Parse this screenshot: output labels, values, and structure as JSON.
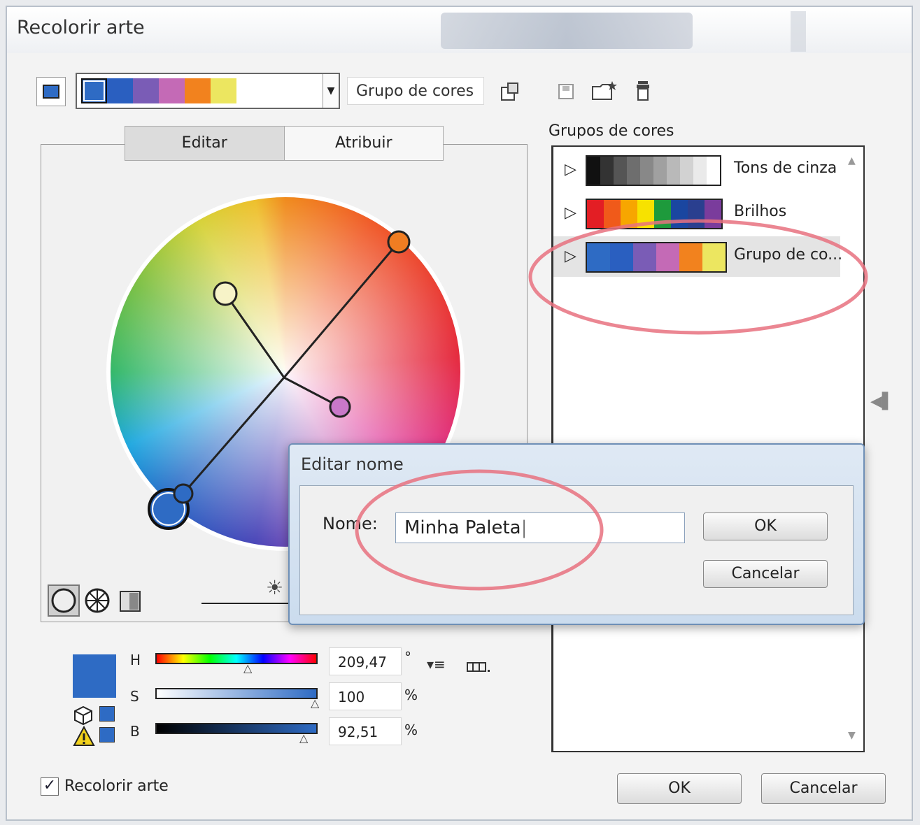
{
  "window": {
    "title": "Recolorir arte"
  },
  "top": {
    "palette_colors": [
      "#2e6bc4",
      "#2a5fc0",
      "#7a5cb6",
      "#c46ab6",
      "#f2821e",
      "#ece660"
    ],
    "group_name_field": "Grupo de cores",
    "icons": [
      "new-from-selection-icon",
      "save-icon",
      "new-group-icon",
      "delete-icon"
    ]
  },
  "tabs": {
    "edit": "Editar",
    "assign": "Atribuir"
  },
  "color_groups": {
    "label": "Grupos de cores",
    "groups": [
      {
        "name": "Tons de cinza",
        "colors": [
          "#111111",
          "#333333",
          "#555555",
          "#6e6e6e",
          "#888888",
          "#a0a0a0",
          "#b9b9b9",
          "#d2d2d2",
          "#eaeaea",
          "#ffffff"
        ]
      },
      {
        "name": "Brilhos",
        "colors": [
          "#e31e24",
          "#f05a1a",
          "#f7a600",
          "#f7e200",
          "#1e9a3c",
          "#1a46a0",
          "#2a3f8f",
          "#7a3c9c"
        ]
      },
      {
        "name": "Grupo de co...",
        "colors": [
          "#2e6bc4",
          "#2a5fc0",
          "#7a5cb6",
          "#c46ab6",
          "#f2821e",
          "#ece660"
        ]
      }
    ]
  },
  "hsb": {
    "h_label": "H",
    "h_value": "209,47",
    "h_unit": "°",
    "s_label": "S",
    "s_value": "100",
    "s_unit": "%",
    "b_label": "B",
    "b_value": "92,51",
    "b_unit": "%",
    "current_color": "#2e6bc4"
  },
  "recolor": {
    "checked": true,
    "label": "Recolorir arte"
  },
  "buttons": {
    "ok": "OK",
    "cancel": "Cancelar"
  },
  "dialog": {
    "title": "Editar nome",
    "name_label": "Nome:",
    "name_value": "Minha Paleta",
    "ok": "OK",
    "cancel": "Cancelar"
  }
}
